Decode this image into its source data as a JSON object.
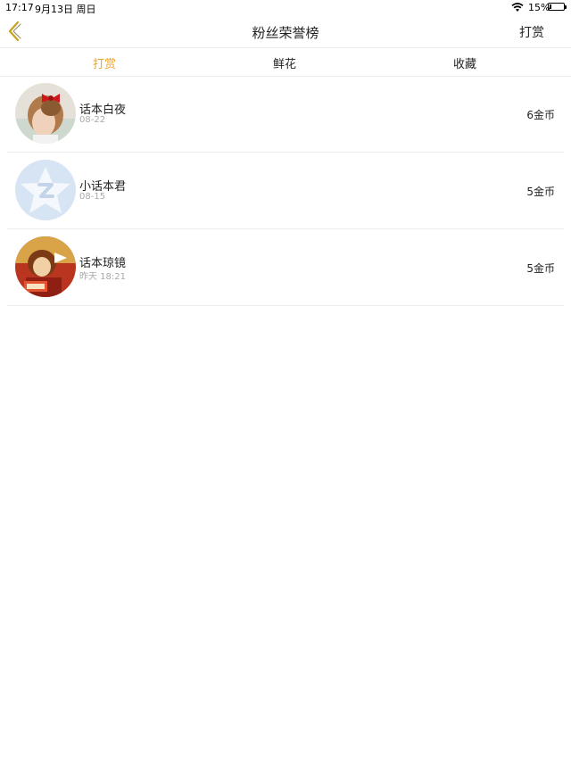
{
  "status_bar": {
    "time": "17:17",
    "date": "9月13日 周日",
    "battery": "15%",
    "battery_level": 0.15
  },
  "nav": {
    "title": "粉丝荣誉榜",
    "right_button": "打赏",
    "back_icon": "chevron-left-icon",
    "accent_color": "#e9a22a"
  },
  "tabs": [
    {
      "label": "打赏",
      "active": true
    },
    {
      "label": "鲜花",
      "active": false
    },
    {
      "label": "收藏",
      "active": false
    }
  ],
  "list": [
    {
      "name": "话本白夜",
      "date": "08-22",
      "amount": "6金币",
      "avatar": "photo-girl-red-bow"
    },
    {
      "name": "小话本君",
      "date": "08-15",
      "amount": "5金币",
      "avatar": "qq-default-avatar"
    },
    {
      "name": "话本琼镜",
      "date": "昨天 18:21",
      "amount": "5金币",
      "avatar": "photo-anime-character"
    }
  ]
}
